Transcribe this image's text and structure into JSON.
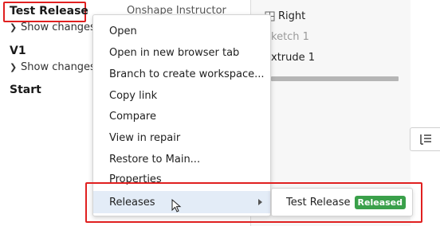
{
  "history": {
    "entries": [
      {
        "title": "Test Release",
        "author": "Onshape Instructor",
        "show_changes": "Show changes"
      },
      {
        "title": "V1",
        "show_changes": "Show changes"
      },
      {
        "title": "Start"
      }
    ]
  },
  "feature_tree": {
    "items": [
      {
        "label": "Right",
        "icon": "plane-icon"
      },
      {
        "label": "ketch 1"
      },
      {
        "label": "xtrude 1"
      }
    ],
    "side_button_icon": "feature-list-icon"
  },
  "context_menu": {
    "items": [
      "Open",
      "Open in new browser tab",
      "Branch to create workspace...",
      "Copy link",
      "Compare",
      "View in repair",
      "Restore to Main...",
      "Properties",
      "Releases"
    ],
    "hovered": "Releases"
  },
  "releases_submenu": {
    "label": "Test Release",
    "badge": "Released",
    "badge_color": "#3aa04a"
  },
  "colors": {
    "highlight_box": "#e02020",
    "hover_bg": "#e3ecf7"
  }
}
